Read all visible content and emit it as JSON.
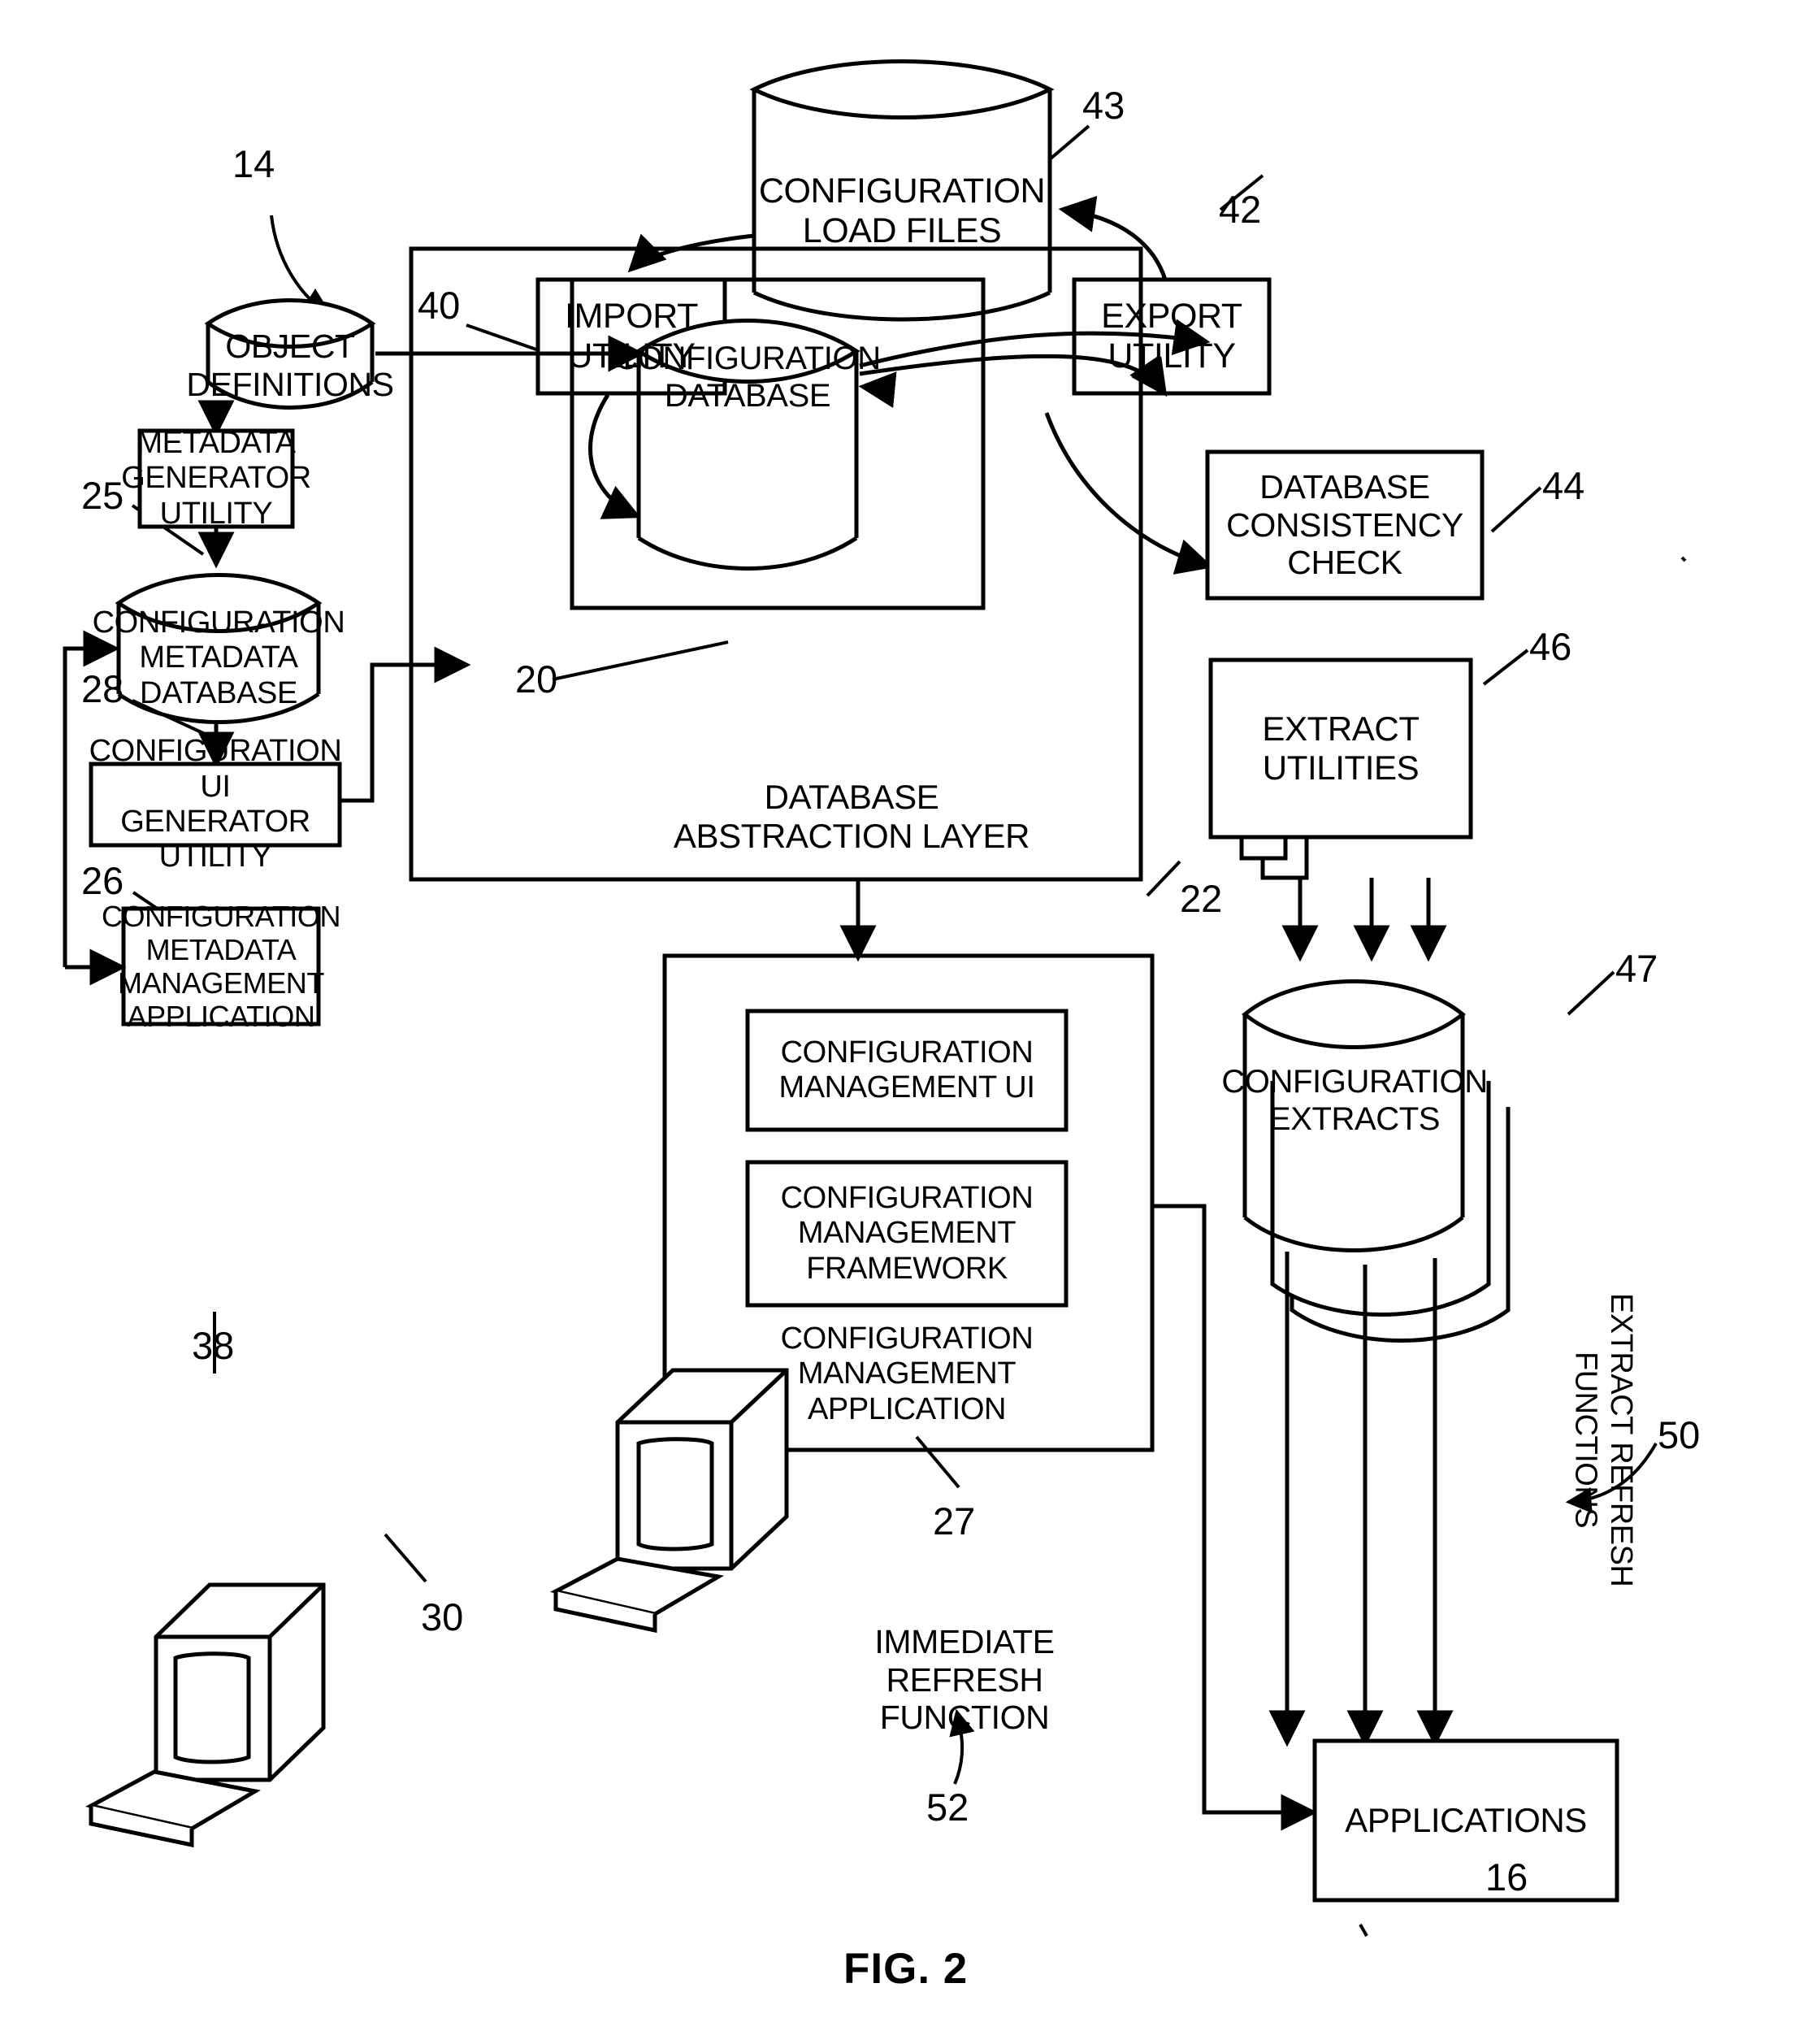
{
  "figure": {
    "caption": "FIG. 2",
    "system_ref": "14"
  },
  "nodes": {
    "config_load_files": {
      "label": "CONFIGURATION\nLOAD FILES",
      "ref": "43",
      "shape": "cylinder"
    },
    "import_utility": {
      "label": "IMPORT\nUTILITY",
      "ref": "40",
      "shape": "box"
    },
    "export_utility": {
      "label": "EXPORT\nUTILITY",
      "ref": "42",
      "shape": "box"
    },
    "object_definitions": {
      "label": "OBJECT\nDEFINITIONS",
      "ref": "25",
      "shape": "cylinder"
    },
    "metadata_generator": {
      "label": "METADATA\nGENERATOR\nUTILITY",
      "ref": "28",
      "shape": "box"
    },
    "config_metadata_db": {
      "label": "CONFIGURATION\nMETADATA\nDATABASE",
      "ref": "26",
      "shape": "cylinder"
    },
    "config_ui_generator": {
      "label": "CONFIGURATION UI\nGENERATOR UTILITY",
      "ref": "38",
      "shape": "box"
    },
    "config_metadata_mgmt_app": {
      "label": "CONFIGURATION\nMETADATA\nMANAGEMENT\nAPPLICATION",
      "ref": "30",
      "shape": "box"
    },
    "config_database": {
      "label": "CONFIGURATION\nDATABASE",
      "ref": "20",
      "shape": "cylinder"
    },
    "database_abstraction_layer": {
      "label": "DATABASE\nABSTRACTION LAYER",
      "ref": "22",
      "shape": "container"
    },
    "db_consistency_check": {
      "label": "DATABASE\nCONSISTENCY\nCHECK",
      "ref": "44",
      "shape": "box"
    },
    "extract_utilities": {
      "label": "EXTRACT\nUTILITIES",
      "ref": "46",
      "shape": "stacked-box"
    },
    "config_extracts": {
      "label": "CONFIGURATION\nEXTRACTS",
      "ref": "47",
      "shape": "stacked-cylinder"
    },
    "config_mgmt_ui": {
      "label": "CONFIGURATION\nMANAGEMENT UI",
      "ref": "",
      "shape": "box"
    },
    "config_mgmt_framework": {
      "label": "CONFIGURATION\nMANAGEMENT\nFRAMEWORK",
      "ref": "",
      "shape": "box"
    },
    "config_mgmt_app": {
      "label": "CONFIGURATION\nMANAGEMENT\nAPPLICATION",
      "ref": "27",
      "shape": "container"
    },
    "applications": {
      "label": "APPLICATIONS",
      "ref": "16",
      "shape": "box"
    }
  },
  "annotations": {
    "extract_refresh_functions": {
      "label": "EXTRACT REFRESH\nFUNCTIONS",
      "ref": "50"
    },
    "immediate_refresh_function": {
      "label": "IMMEDIATE\nREFRESH FUNCTION",
      "ref": "52"
    }
  },
  "refs": {
    "r14": "14",
    "r16": "16",
    "r20": "20",
    "r22": "22",
    "r25": "25",
    "r26": "26",
    "r27": "27",
    "r28": "28",
    "r30": "30",
    "r38": "38",
    "r40": "40",
    "r42": "42",
    "r43": "43",
    "r44": "44",
    "r46": "46",
    "r47": "47",
    "r50": "50",
    "r52": "52"
  },
  "colors": {
    "stroke": "#000000",
    "background": "#ffffff"
  },
  "workstations": [
    {
      "name": "metadata-management-workstation"
    },
    {
      "name": "configuration-management-workstation"
    }
  ]
}
